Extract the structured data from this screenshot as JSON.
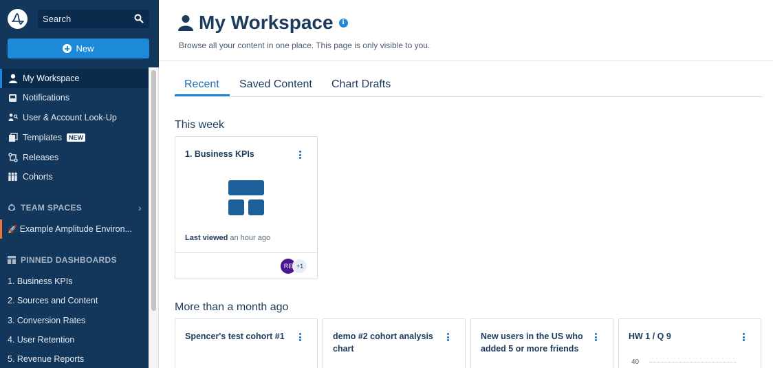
{
  "sidebar": {
    "search": {
      "label": "Search"
    },
    "new_button": {
      "label": "New"
    },
    "nav": [
      {
        "label": "My Workspace",
        "icon": "person-icon",
        "active": true
      },
      {
        "label": "Notifications",
        "icon": "inbox-icon"
      },
      {
        "label": "User & Account Look-Up",
        "icon": "user-lookup-icon"
      },
      {
        "label": "Templates",
        "icon": "templates-icon",
        "badge": "NEW"
      },
      {
        "label": "Releases",
        "icon": "releases-icon"
      },
      {
        "label": "Cohorts",
        "icon": "cohorts-icon"
      }
    ],
    "team_spaces": {
      "label": "TEAM SPACES"
    },
    "environment": {
      "label": "Example Amplitude Environ...",
      "icon": "rocket-icon"
    },
    "pinned": {
      "label": "PINNED DASHBOARDS"
    },
    "pinned_items": [
      "1. Business KPIs",
      "2. Sources and Content",
      "3. Conversion Rates",
      "4. User Retention",
      "5. Revenue Reports"
    ]
  },
  "header": {
    "title": "My Workspace",
    "subtitle": "Browse all your content in one place. This page is only visible to you."
  },
  "tabs": [
    {
      "label": "Recent",
      "active": true
    },
    {
      "label": "Saved Content"
    },
    {
      "label": "Chart Drafts"
    }
  ],
  "sections": {
    "this_week": "This week",
    "month_ago": "More than a month ago"
  },
  "recent_card": {
    "title": "1. Business KPIs",
    "last_viewed_label": "Last viewed",
    "last_viewed_time": "an hour ago",
    "avatar": "RE",
    "more_count": "+1"
  },
  "older_cards": [
    {
      "title": "Spencer's test cohort #1"
    },
    {
      "title": "demo #2 cohort analysis chart"
    },
    {
      "title": "New users in the US who added 5 or more friends"
    },
    {
      "title": "HW 1 / Q 9",
      "tick": "40"
    }
  ],
  "colors": {
    "sidebar": "#13375b",
    "accent": "#1d89d9",
    "text": "#1c3a5c"
  }
}
